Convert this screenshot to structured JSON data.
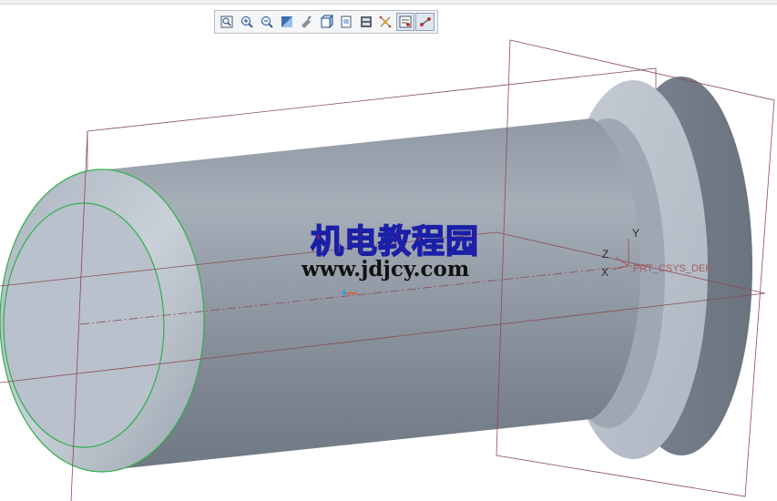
{
  "toolbar": {
    "buttons": [
      {
        "name": "refit-icon"
      },
      {
        "name": "zoom-in-icon"
      },
      {
        "name": "zoom-out-icon"
      },
      {
        "name": "repaint-icon"
      },
      {
        "name": "orient-icon"
      },
      {
        "name": "display-style-icon"
      },
      {
        "name": "saved-views-icon"
      },
      {
        "name": "view-manager-icon"
      },
      {
        "name": "datum-display-icon"
      },
      {
        "name": "annotation-display-icon"
      },
      {
        "name": "spin-center-icon"
      }
    ]
  },
  "watermark": {
    "chinese": "机电教程园",
    "url": "www.jdjcy.com"
  },
  "csys": {
    "y_label": "Y",
    "z_label": "Z",
    "x_label": "X",
    "name": "PRT_CSYS_DEF"
  },
  "colors": {
    "model_body": "#8e97a3",
    "model_highlight": "#c2c9d3",
    "datum_plane": "#8c4b55",
    "edge_selected": "#2fb04a"
  }
}
